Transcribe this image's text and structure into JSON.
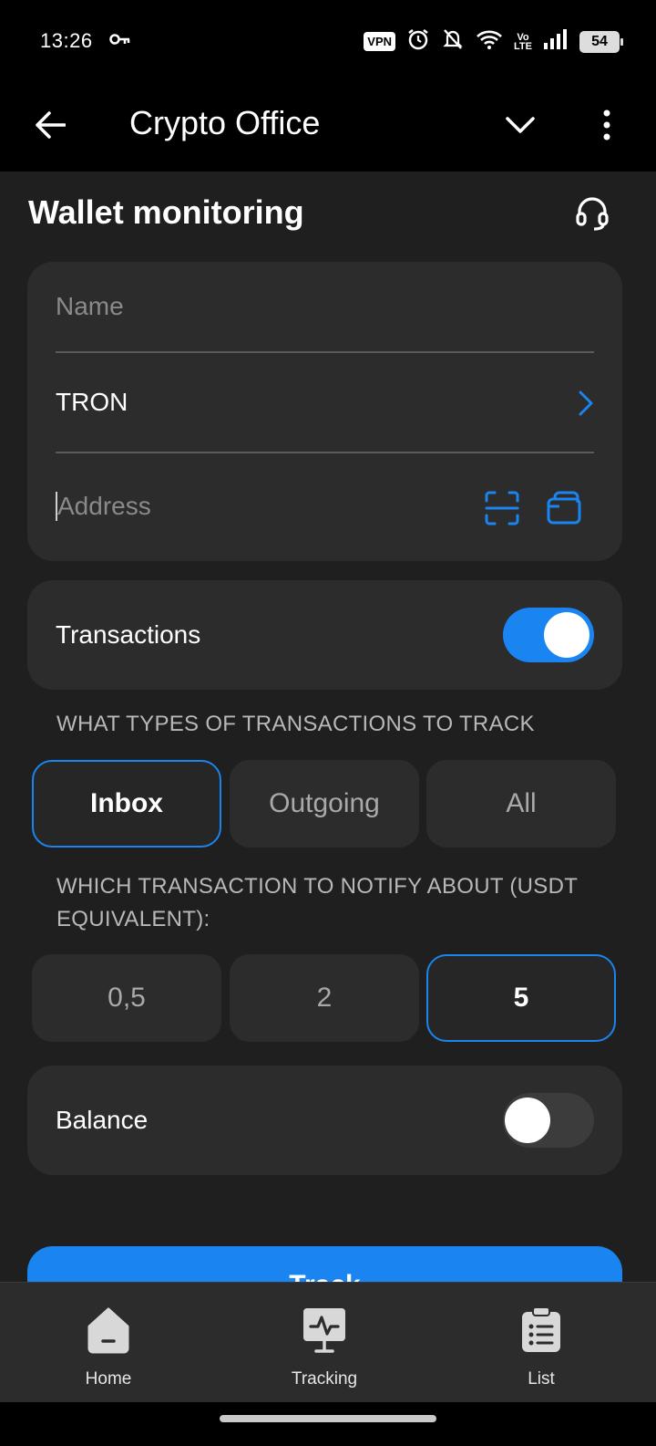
{
  "status_bar": {
    "time": "13:26",
    "vpn": "VPN",
    "volte_top": "Vo",
    "volte_bottom": "LTE",
    "battery": "54"
  },
  "app_bar": {
    "title": "Crypto Office"
  },
  "page": {
    "title": "Wallet monitoring"
  },
  "form": {
    "name_placeholder": "Name",
    "network_value": "TRON",
    "address_placeholder": "Address"
  },
  "transactions": {
    "label": "Transactions",
    "enabled": true,
    "types_label": "WHAT TYPES OF TRANSACTIONS TO TRACK",
    "types": [
      "Inbox",
      "Outgoing",
      "All"
    ],
    "selected_type": "Inbox",
    "notify_label": "WHICH TRANSACTION TO NOTIFY ABOUT (USDT EQUIVALENT):",
    "amounts": [
      "0,5",
      "2",
      "5"
    ],
    "selected_amount": "5"
  },
  "balance": {
    "label": "Balance",
    "enabled": false
  },
  "track_button": {
    "label": "Track"
  },
  "bottom_nav": {
    "items": [
      {
        "label": "Home",
        "icon": "home-icon"
      },
      {
        "label": "Tracking",
        "icon": "tracking-icon"
      },
      {
        "label": "List",
        "icon": "list-icon"
      }
    ]
  },
  "colors": {
    "accent": "#1a84f0",
    "background": "#1f1f1f",
    "card": "#2c2c2c"
  }
}
